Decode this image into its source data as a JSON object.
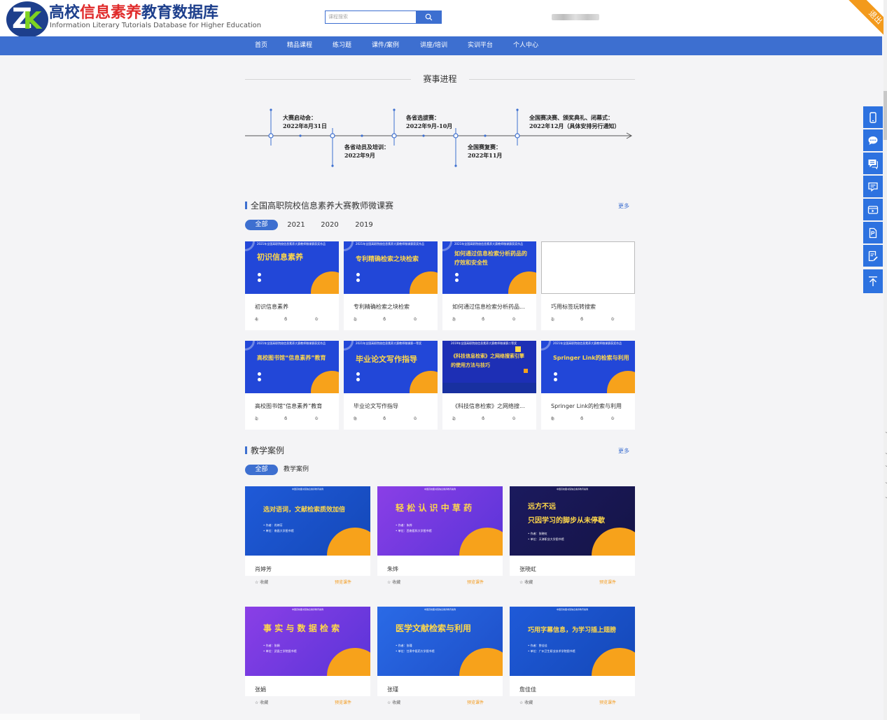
{
  "header": {
    "logo_text": "ZK",
    "title_part1": "高校",
    "title_part2": "信息素养",
    "title_part3": "教育数据库",
    "subtitle": "Information Literary Tutorials Database for Higher Education",
    "search_placeholder": "课程搜索",
    "exit_label": "退出"
  },
  "nav": {
    "items": [
      "首页",
      "精品课程",
      "练习题",
      "课件/案例",
      "讲座/培训",
      "实训平台",
      "个人中心"
    ]
  },
  "timeline": {
    "title": "赛事进程",
    "events": [
      {
        "name": "大赛启动会：",
        "date": "2022年8月31日"
      },
      {
        "name": "各省动员及培训：",
        "date": "2022年9月"
      },
      {
        "name": "各省选拔赛：",
        "date": "2022年9月-10月"
      },
      {
        "name": "全国赛复赛：",
        "date": "2022年11月"
      },
      {
        "name": "全国赛决赛、颁奖典礼、闭幕式：",
        "date": "2022年12月（具体安排另行通知）"
      }
    ]
  },
  "micro": {
    "title": "全国高职院校信息素养大赛教师微课赛",
    "more": "更多",
    "filters": [
      "全部",
      "2021",
      "2020",
      "2019"
    ],
    "cards": [
      {
        "thumb_title": "初识信息素养",
        "name": "初识信息素养",
        "views": "4",
        "likes": "0",
        "favs": "0",
        "thumb_header": "2021年全国高职院校信息素养大赛教师微课赛获奖作品"
      },
      {
        "thumb_title": "专利精确检索之块检索",
        "name": "专利精确检索之块检索",
        "views": "1",
        "likes": "0",
        "favs": "0",
        "thumb_header": "2021年全国高职院校信息素养大赛教师微课赛获奖作品"
      },
      {
        "thumb_title": "如何通过信息检索分析药品的疗效和安全性",
        "name": "如何通过信息检索分析药品...",
        "views": "3",
        "likes": "0",
        "favs": "0",
        "thumb_header": "2021年全国高职院校信息素养大赛教师微课赛获奖作品"
      },
      {
        "thumb_title": "",
        "name": "巧用标签玩转搜索",
        "views": "1",
        "likes": "0",
        "favs": "0",
        "thumb_header": ""
      },
      {
        "thumb_title": "高校图书馆“信息素养”教育",
        "name": "高校图书馆“信息素养”教育",
        "views": "1",
        "likes": "0",
        "favs": "0",
        "thumb_header": "2021年全国高职院校信息素养大赛教师微课赛获奖作品"
      },
      {
        "thumb_title": "毕业论文写作指导",
        "name": "毕业论文写作指导",
        "views": "9",
        "likes": "0",
        "favs": "0",
        "thumb_header": "2021年全国高职院校信息素养大赛教师微课赛一等奖"
      },
      {
        "thumb_title": "《科技信息检索》之网络搜索引擎的使用方法与技巧",
        "name": "《科技信息检索》之网络搜...",
        "views": "2",
        "likes": "0",
        "favs": "0",
        "thumb_header": "2019年全国高职院校信息素养大赛教师微课赛二等奖"
      },
      {
        "thumb_title": "Springer Link的检索与利用",
        "name": "Springer Link的检索与利用",
        "views": "8",
        "likes": "0",
        "favs": "0",
        "thumb_header": "2021年全国高职院校信息素养大赛教师微课赛获奖作品"
      }
    ]
  },
  "cases": {
    "title": "教学案例",
    "more": "更多",
    "filters": [
      "全部",
      "教学案例"
    ],
    "fav_label": "☆ 收藏",
    "preview_label": "预览课件",
    "items": [
      {
        "thumb_title": "选对语词，文献检索质效加倍",
        "thumb_title2": "",
        "author": "• 作者：肖婷芳",
        "unit": "• 单位：南昌大学图书馆",
        "name": "肖婷芳",
        "theme": "blue"
      },
      {
        "thumb_title": "轻 松 认 识 中 草 药",
        "thumb_title2": "",
        "author": "• 作者：朱烨",
        "unit": "• 单位：西南医科大学图书馆",
        "name": "朱烨",
        "theme": "purple"
      },
      {
        "thumb_title": "远方不远",
        "thumb_title2": "只因学习的脚步从未停歇",
        "author": "• 作者：张晓虹",
        "unit": "• 单位：天津职业大学图书馆",
        "name": "张晓虹",
        "theme": "navy"
      },
      {
        "thumb_title": "事 实 与 数 据 检 索",
        "thumb_title2": "",
        "author": "• 作者：张娟",
        "unit": "• 单位：武昌工学院图书馆",
        "name": "张娟",
        "theme": "purple"
      },
      {
        "thumb_title": "医学文献检索与利用",
        "thumb_title2": "",
        "author": "• 作者：张瑾",
        "unit": "• 单位：甘肃中医药大学图书馆",
        "name": "张瑾",
        "theme": "blue2"
      },
      {
        "thumb_title": "巧用字幕信息，为学习插上翅膀",
        "thumb_title2": "",
        "author": "• 作者：詹佳佳",
        "unit": "• 单位：广州卫生职业技术学院图书馆",
        "name": "詹佳佳",
        "theme": "blue"
      }
    ]
  },
  "sidetools": [
    "mobile-icon",
    "chat-bubble-icon",
    "message-icon",
    "comment-icon",
    "video-icon",
    "document-icon",
    "edit-icon",
    "back-to-top-icon"
  ],
  "colors": {
    "brand": "#3d6fd0",
    "accent": "#f39a1c",
    "tool": "#2d72e0"
  }
}
